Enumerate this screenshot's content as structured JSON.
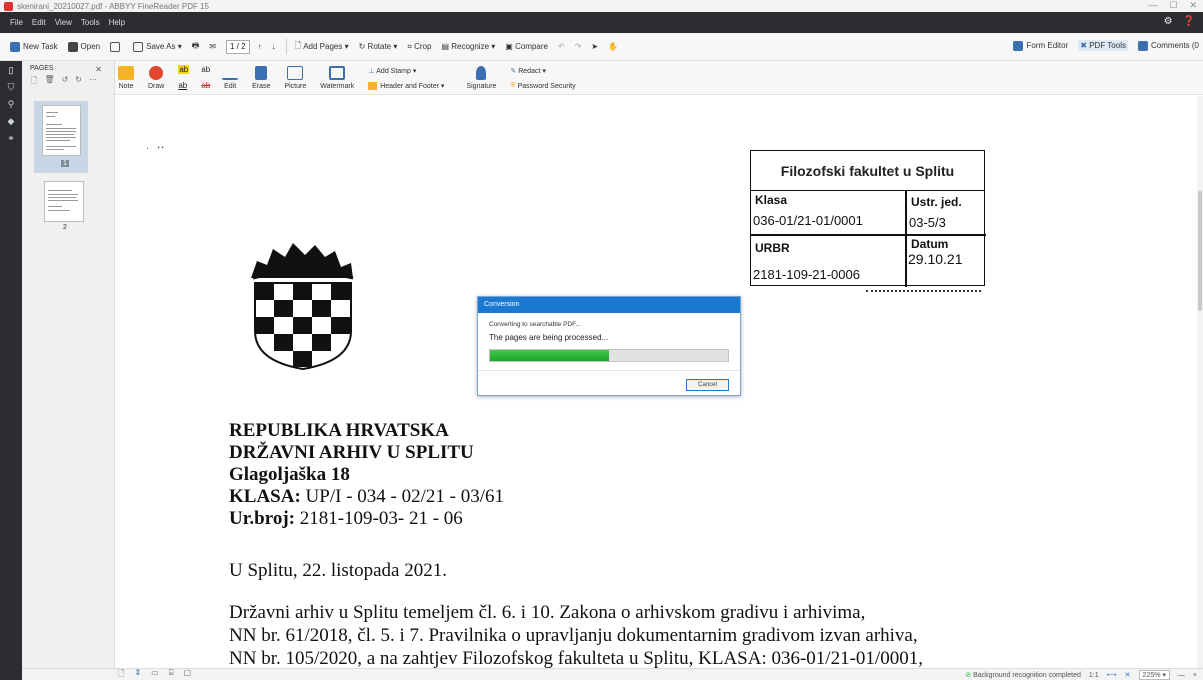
{
  "window": {
    "title": "skenirani_20210027.pdf - ABBYY FineReader PDF 15",
    "controls": [
      "—",
      "☐",
      "✕"
    ]
  },
  "menu": {
    "items": [
      "File",
      "Edit",
      "View",
      "Tools",
      "Help"
    ]
  },
  "toolbar": {
    "new_task": "New Task",
    "open": "Open",
    "save_as": "Save As",
    "page_indicator": "1 / 2",
    "add_pages": "Add Pages",
    "rotate": "Rotate",
    "crop": "Crop",
    "recognize": "Recognize",
    "compare": "Compare",
    "form_editor": "Form Editor",
    "pdf_tools": "PDF Tools",
    "comments": "Comments (0"
  },
  "tools": {
    "note": "Note",
    "draw": "Draw",
    "edit": "Edit",
    "erase": "Erase",
    "picture": "Picture",
    "watermark": "Watermark",
    "add_stamp": "Add Stamp",
    "header_footer": "Header and Footer",
    "signature": "Signature",
    "redact": "Redact",
    "password_security": "Password Security"
  },
  "pages_panel": {
    "title": "PAGES",
    "page1": "1",
    "page2": "2"
  },
  "document": {
    "stamp": {
      "institution": "Filozofski fakultet u Splitu",
      "klasa_label": "Klasa",
      "klasa_value": "036-01/21-01/0001",
      "ustr_label": "Ustr. jed.",
      "ustr_value": "03-5/3",
      "urbr_label": "URBR",
      "urbr_value": "2181-109-21-0006",
      "datum_label": "Datum",
      "datum_value": "29.10.21"
    },
    "header": {
      "line1": "REPUBLIKA HRVATSKA",
      "line2": "DRŽAVNI ARHIV U SPLITU",
      "line3": "Glagoljaška 18",
      "klasa_label": "KLASA:",
      "klasa_value": " UP/I - 034 - 02/21 - 03/61",
      "urbroj_label": "Ur.broj:",
      "urbroj_value": " 2181-109-03- 21 - 06"
    },
    "date_line": "U Splitu, 22. listopada 2021.",
    "body": [
      "Državni arhiv u Splitu temeljem čl. 6. i 10. Zakona o arhivskom gradivu i arhivima,",
      "NN br. 61/2018,  čl. 5. i  7. Pravilnika o upravljanju dokumentarnim gradivom izvan arhiva,",
      "NN br. 105/2020, a na zahtjev Filozofskog fakulteta u Splitu, KLASA: 036-01/21-01/0001,"
    ]
  },
  "dialog": {
    "title": "Conversion",
    "line1": "Converting to searchable PDF...",
    "line2": "The pages are being processed...",
    "progress": 0.5,
    "cancel": "Cancel"
  },
  "status": {
    "message": "Background recognition completed",
    "ratio": "1:1",
    "zoom": "225%"
  },
  "colors": {
    "accent": "#1b79d1",
    "progress": "#2cb53a",
    "dark": "#2b2d30"
  }
}
